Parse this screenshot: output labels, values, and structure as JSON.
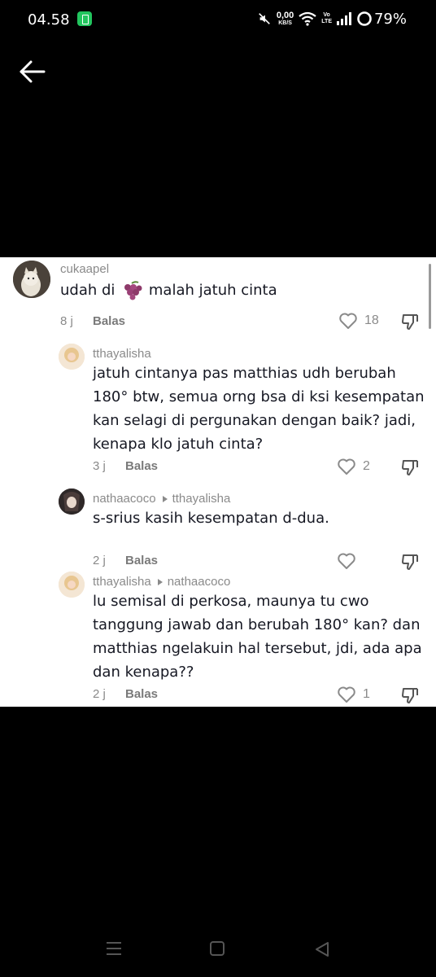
{
  "status_bar": {
    "time": "04.58",
    "network_speed_value": "0,00",
    "network_speed_unit": "KB/S",
    "volte_label": "Vo\nLTE",
    "battery_percent": "79%"
  },
  "comments": [
    {
      "username": "cukaapel",
      "reply_to": "",
      "text_before_emoji": "udah di ",
      "emoji": "grapes-emoji",
      "text_after_emoji": " malah jatuh cinta",
      "time": "8 j",
      "reply_label": "Balas",
      "likes": "18"
    },
    {
      "username": "tthayalisha",
      "reply_to": "",
      "lines": [
        "jatuh cintanya pas matthias udh berubah",
        "180° btw, semua orng bsa di ksi kesempatan",
        "kan selagi di pergunakan dengan baik? jadi,",
        "kenapa klo jatuh cinta?"
      ],
      "time": "3 j",
      "reply_label": "Balas",
      "likes": "2"
    },
    {
      "username": "nathaacoco",
      "reply_to": "tthayalisha",
      "lines": [
        "s-srius kasih kesempatan d-dua."
      ],
      "time": "2 j",
      "reply_label": "Balas",
      "likes": ""
    },
    {
      "username": "tthayalisha",
      "reply_to": "nathaacoco",
      "lines": [
        "lu semisal di perkosa, maunya tu cwo",
        "tanggung jawab dan berubah 180° kan? dan",
        "matthias ngelakuin hal tersebut, jdi, ada apa",
        "dan kenapa??"
      ],
      "time": "2 j",
      "reply_label": "Balas",
      "likes": "1"
    }
  ],
  "icons": {
    "back": "arrow-left-icon",
    "like": "heart-outline-icon",
    "dislike": "thumbs-down-icon",
    "reply_caret": "caret-right-icon",
    "nav_menu": "recent-apps-icon",
    "nav_home": "home-square-icon",
    "nav_back": "triangle-back-icon"
  },
  "colors": {
    "background": "#000000",
    "panel": "#ffffff",
    "text": "#161823",
    "muted": "#8a8a8a",
    "notification_green": "#22c55e"
  }
}
